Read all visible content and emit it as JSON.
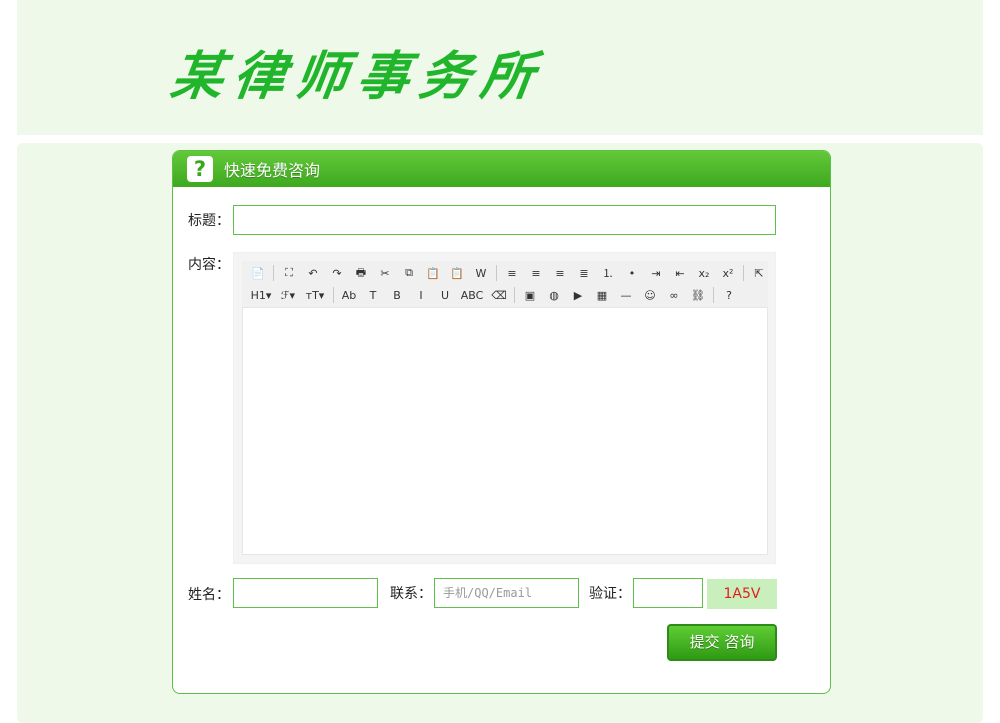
{
  "logo": {
    "text": "某律师事务所"
  },
  "panel": {
    "title": "快速免费咨询",
    "help_icon": "?"
  },
  "form": {
    "title_label": "标题：",
    "title_value": "",
    "content_label": "内容：",
    "name_label": "姓名：",
    "name_value": "",
    "contact_label": "联系：",
    "contact_placeholder": "手机/QQ/Email",
    "verify_label": "验证：",
    "verify_value": "",
    "captcha": "1A5V",
    "submit_label": "提交 咨询"
  },
  "toolbar": {
    "row1": [
      {
        "name": "source-icon",
        "glyph": "📄"
      },
      {
        "name": "fullscreen-icon",
        "glyph": "⛶"
      },
      {
        "name": "undo-icon",
        "glyph": "↶"
      },
      {
        "name": "redo-icon",
        "glyph": "↷"
      },
      {
        "name": "print-icon",
        "glyph": "🖶"
      },
      {
        "name": "cut-icon",
        "glyph": "✂"
      },
      {
        "name": "copy-icon",
        "glyph": "⧉"
      },
      {
        "name": "paste-icon",
        "glyph": "📋"
      },
      {
        "name": "paste-text-icon",
        "glyph": "📋"
      },
      {
        "name": "paste-word-icon",
        "glyph": "W"
      },
      {
        "name": "align-left-icon",
        "glyph": "≡"
      },
      {
        "name": "align-center-icon",
        "glyph": "≡"
      },
      {
        "name": "align-right-icon",
        "glyph": "≡"
      },
      {
        "name": "justify-icon",
        "glyph": "≣"
      },
      {
        "name": "ordered-list-icon",
        "glyph": "⒈"
      },
      {
        "name": "unordered-list-icon",
        "glyph": "•"
      },
      {
        "name": "indent-icon",
        "glyph": "⇥"
      },
      {
        "name": "outdent-icon",
        "glyph": "⇤"
      },
      {
        "name": "subscript-icon",
        "glyph": "x₂"
      },
      {
        "name": "superscript-icon",
        "glyph": "x²"
      },
      {
        "name": "select-all-icon",
        "glyph": "⇱"
      }
    ],
    "row2": [
      {
        "name": "heading-icon",
        "glyph": "H1▾"
      },
      {
        "name": "font-family-icon",
        "glyph": "ℱ▾"
      },
      {
        "name": "font-size-icon",
        "glyph": "тT▾"
      },
      {
        "name": "font-color-icon",
        "glyph": "Ab"
      },
      {
        "name": "highlight-icon",
        "glyph": "T"
      },
      {
        "name": "bold-icon",
        "glyph": "B"
      },
      {
        "name": "italic-icon",
        "glyph": "I"
      },
      {
        "name": "underline-icon",
        "glyph": "U"
      },
      {
        "name": "strikethrough-icon",
        "glyph": "ABC"
      },
      {
        "name": "remove-format-icon",
        "glyph": "⌫"
      },
      {
        "name": "image-icon",
        "glyph": "▣"
      },
      {
        "name": "flash-icon",
        "glyph": "◍"
      },
      {
        "name": "media-icon",
        "glyph": "▶"
      },
      {
        "name": "table-icon",
        "glyph": "▦"
      },
      {
        "name": "hr-icon",
        "glyph": "—"
      },
      {
        "name": "emoticon-icon",
        "glyph": "☺"
      },
      {
        "name": "link-icon",
        "glyph": "∞"
      },
      {
        "name": "unlink-icon",
        "glyph": "⛓"
      },
      {
        "name": "about-icon",
        "glyph": "?"
      }
    ]
  },
  "colors": {
    "brand_green": "#3ea81f",
    "border": "#5cc04a",
    "bg": "#eef9ea",
    "captcha_text": "#e0201a"
  }
}
